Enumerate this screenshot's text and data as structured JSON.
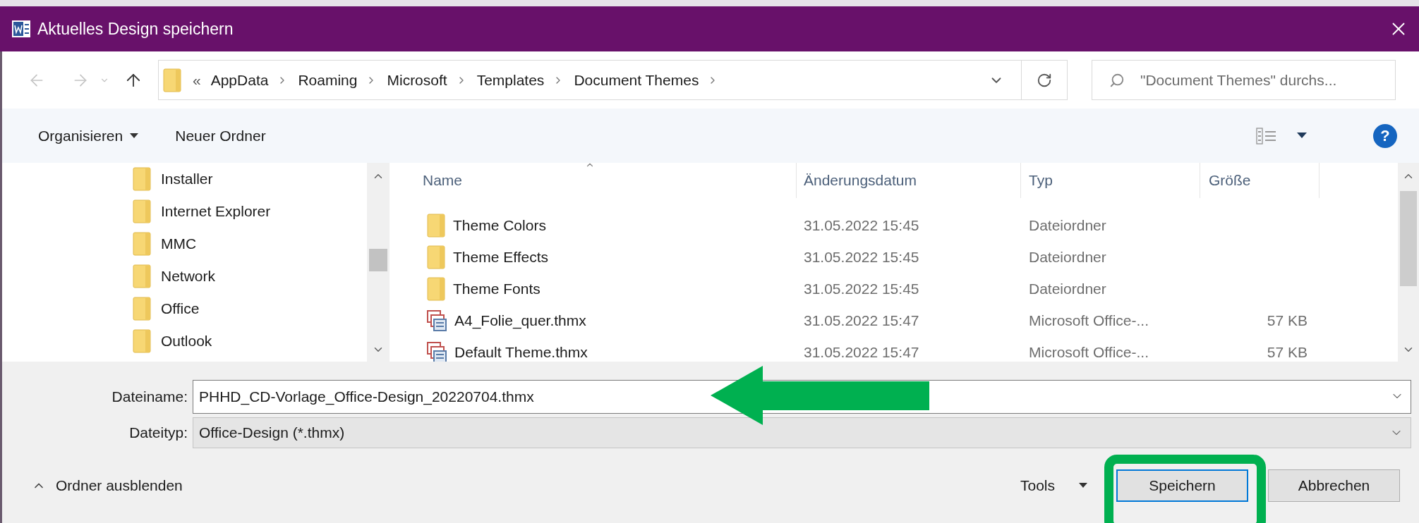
{
  "window": {
    "title": "Aktuelles Design speichern"
  },
  "navigation": {
    "back": {
      "disabled": true
    },
    "forward": {
      "disabled": true
    },
    "up": {
      "disabled": false
    }
  },
  "address_bar": {
    "overflow": "«",
    "path": [
      "AppData",
      "Roaming",
      "Microsoft",
      "Templates",
      "Document Themes"
    ]
  },
  "search": {
    "placeholder": "\"Document Themes\" durchs..."
  },
  "toolbar": {
    "buttons": [
      {
        "label": "Organisieren",
        "menu": true
      },
      {
        "label": "Neuer Ordner",
        "menu": false
      }
    ],
    "help": "?"
  },
  "tree": {
    "items": [
      {
        "label": "Installer"
      },
      {
        "label": "Internet Explorer"
      },
      {
        "label": "MMC"
      },
      {
        "label": "Network"
      },
      {
        "label": "Office"
      },
      {
        "label": "Outlook"
      }
    ]
  },
  "file_list": {
    "columns": [
      {
        "label": "Name",
        "sorted": true
      },
      {
        "label": "Änderungsdatum",
        "sorted": false
      },
      {
        "label": "Typ",
        "sorted": false
      },
      {
        "label": "Größe",
        "sorted": false
      }
    ],
    "rows": [
      {
        "kind": "folder",
        "name": "Theme Colors",
        "modified": "31.05.2022 15:45",
        "type": "Dateiordner"
      },
      {
        "kind": "folder",
        "name": "Theme Effects",
        "modified": "31.05.2022 15:45",
        "type": "Dateiordner"
      },
      {
        "kind": "folder",
        "name": "Theme Fonts",
        "modified": "31.05.2022 15:45",
        "type": "Dateiordner"
      },
      {
        "kind": "file",
        "name": "A4_Folie_quer.thmx",
        "modified": "31.05.2022 15:47",
        "type": "Microsoft Office-...",
        "size": "57 KB"
      },
      {
        "kind": "file",
        "name": "Default Theme.thmx",
        "modified": "31.05.2022 15:47",
        "type": "Microsoft Office-...",
        "size": "57 KB"
      }
    ]
  },
  "fields": [
    {
      "label": "Dateiname:",
      "value": "PHHD_CD-Vorlage_Office-Design_20220704.thmx",
      "editable": true
    },
    {
      "label": "Dateityp:",
      "value": "Office-Design (*.thmx)",
      "editable": false
    }
  ],
  "footer": {
    "toggle": "Ordner ausblenden",
    "tools": "Tools",
    "buttons": [
      {
        "label": "Speichern",
        "default": true
      },
      {
        "label": "Abbrechen",
        "default": false
      }
    ]
  }
}
